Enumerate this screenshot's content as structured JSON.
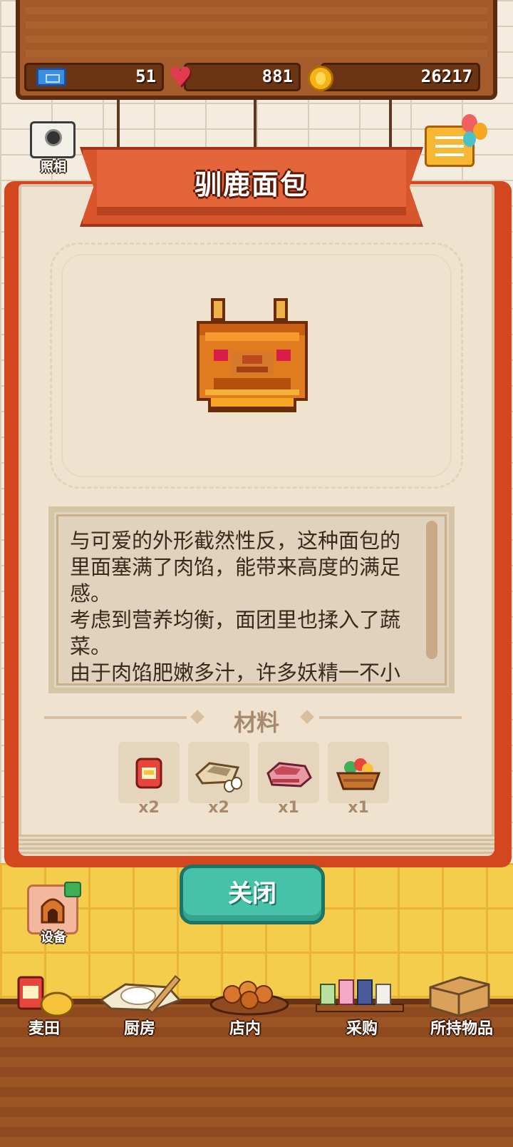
{
  "resources": {
    "tickets": "51",
    "hearts": "881",
    "coins": "26217"
  },
  "camera_label": "照相",
  "title": "驯鹿面包",
  "description": "与可爱的外形截然性反，这种面包的里面塞满了肉馅，能带来高度的满足感。\n考虑到营养均衡，面团里也揉入了蔬菜。\n由于肉馅肥嫩多汁，许多妖精一不小心，就会把油水滴得到处都是",
  "materials_title": "材料",
  "materials": [
    {
      "icon": "flour-bag-icon",
      "count": "x2"
    },
    {
      "icon": "butter-egg-icon",
      "count": "x2"
    },
    {
      "icon": "meat-icon",
      "count": "x1"
    },
    {
      "icon": "vegetable-basket-icon",
      "count": "x1"
    }
  ],
  "close_label": "关闭",
  "equipment_label": "设备",
  "nav": [
    {
      "label": "麦田",
      "icon": "wheat-field-icon"
    },
    {
      "label": "厨房",
      "icon": "kitchen-icon"
    },
    {
      "label": "店内",
      "icon": "shop-icon"
    },
    {
      "label": "采购",
      "icon": "purchase-icon"
    },
    {
      "label": "所持物品",
      "icon": "inventory-icon"
    }
  ],
  "colors": {
    "ribbon": "#e4653a",
    "book_cover": "#d3461e",
    "close_button": "#45c2a8",
    "page": "#efe3cf"
  }
}
